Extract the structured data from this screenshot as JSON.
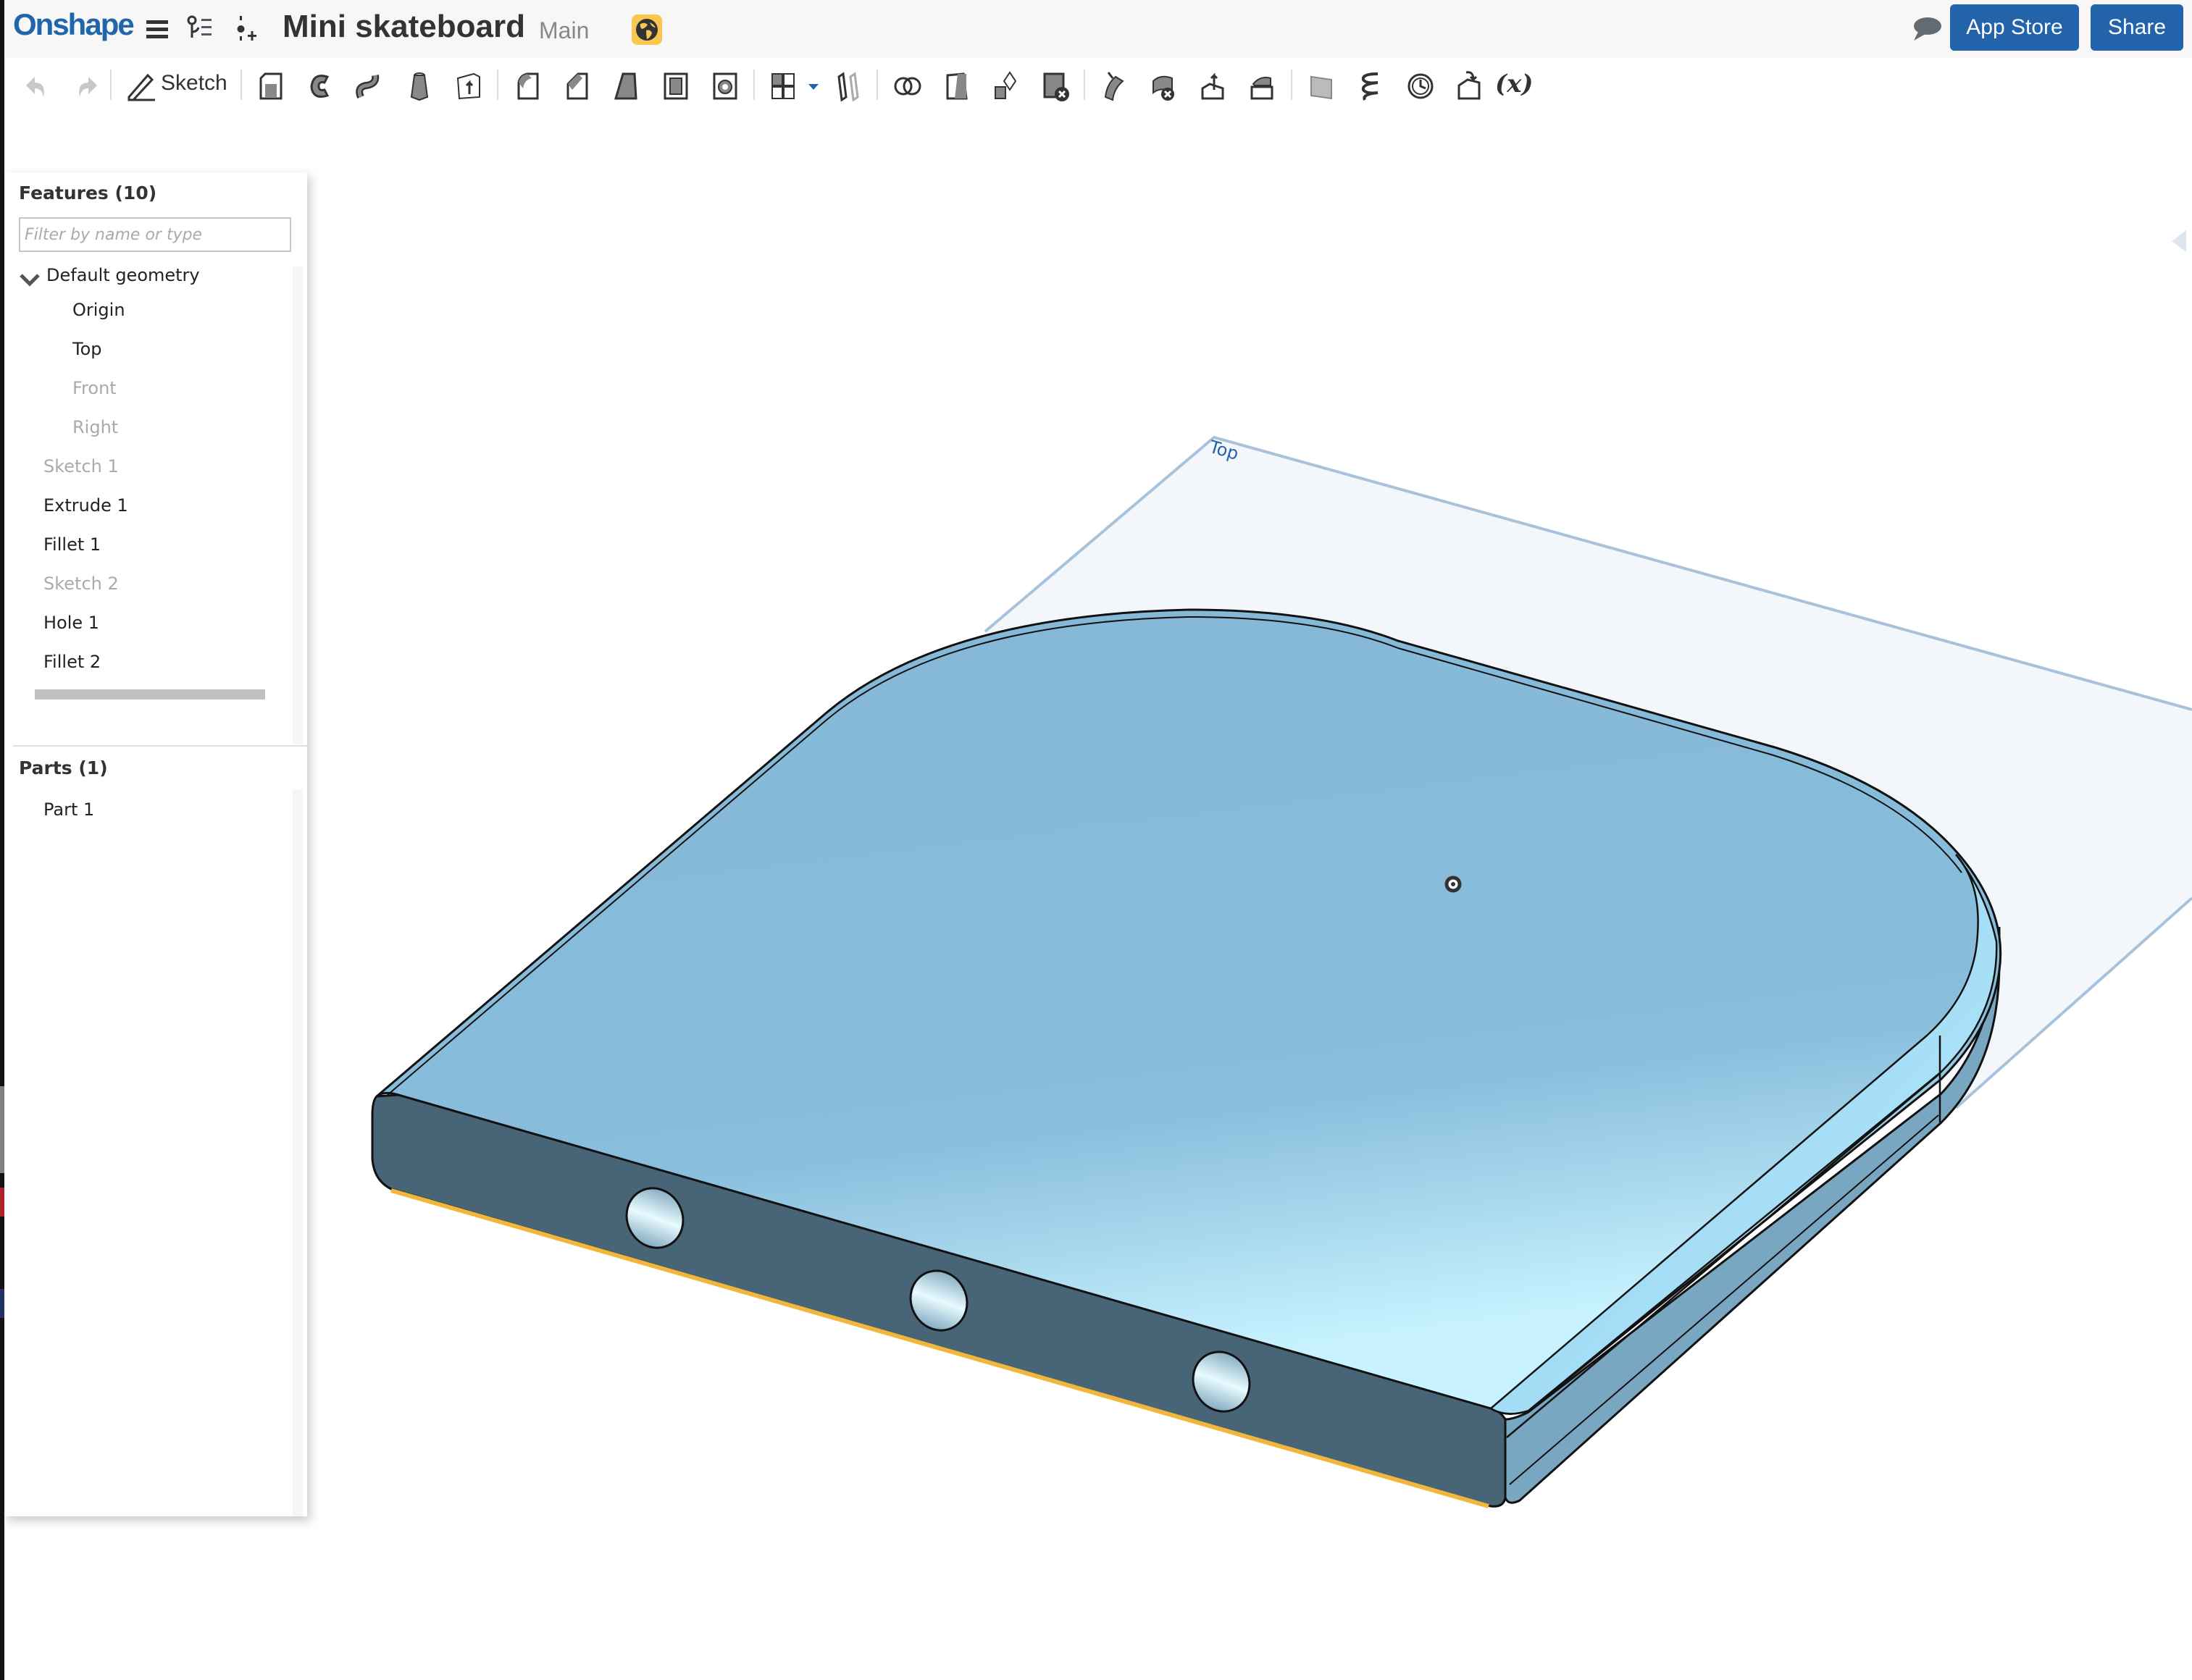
{
  "header": {
    "logo": "Onshape",
    "document_title": "Mini skateboard",
    "workspace": "Main",
    "app_store_label": "App Store",
    "share_label": "Share",
    "icons": [
      "menu-icon",
      "feature-list-icon",
      "insert-icon",
      "public-globe-icon",
      "comment-icon"
    ]
  },
  "toolbar": {
    "sketch_label": "Sketch",
    "variable_label": "(x)",
    "tools": [
      "undo",
      "redo",
      "sketch",
      "extrude",
      "revolve",
      "sweep",
      "loft",
      "thicken",
      "fillet",
      "chamfer",
      "draft",
      "shell",
      "hole",
      "pattern",
      "mirror",
      "boolean",
      "split",
      "transform",
      "delete-part",
      "modify-fillet",
      "delete-face",
      "move-face",
      "replace-face",
      "plane",
      "helix",
      "mate-connector",
      "derived",
      "variable"
    ]
  },
  "features_panel": {
    "title": "Features (10)",
    "filter_placeholder": "Filter by name or type",
    "group_label": "Default geometry",
    "group_items": [
      {
        "label": "Origin",
        "dimmed": false
      },
      {
        "label": "Top",
        "dimmed": false
      },
      {
        "label": "Front",
        "dimmed": true
      },
      {
        "label": "Right",
        "dimmed": true
      }
    ],
    "features": [
      {
        "label": "Sketch 1",
        "dimmed": true
      },
      {
        "label": "Extrude 1",
        "dimmed": false
      },
      {
        "label": "Fillet 1",
        "dimmed": false
      },
      {
        "label": "Sketch 2",
        "dimmed": true
      },
      {
        "label": "Hole 1",
        "dimmed": false
      },
      {
        "label": "Fillet 2",
        "dimmed": false
      }
    ]
  },
  "parts_panel": {
    "title": "Parts (1)",
    "parts": [
      "Part 1"
    ]
  },
  "viewport": {
    "plane_label": "Top",
    "colors": {
      "accent": "#2263aa",
      "part_top": "#84b8d6",
      "part_side_dark": "#486577",
      "part_side_light": "#79a7c2",
      "plane_fill": "#f3f7fb",
      "plane_edge": "#a9c2dc",
      "selection_edge": "#f0b73c"
    }
  }
}
